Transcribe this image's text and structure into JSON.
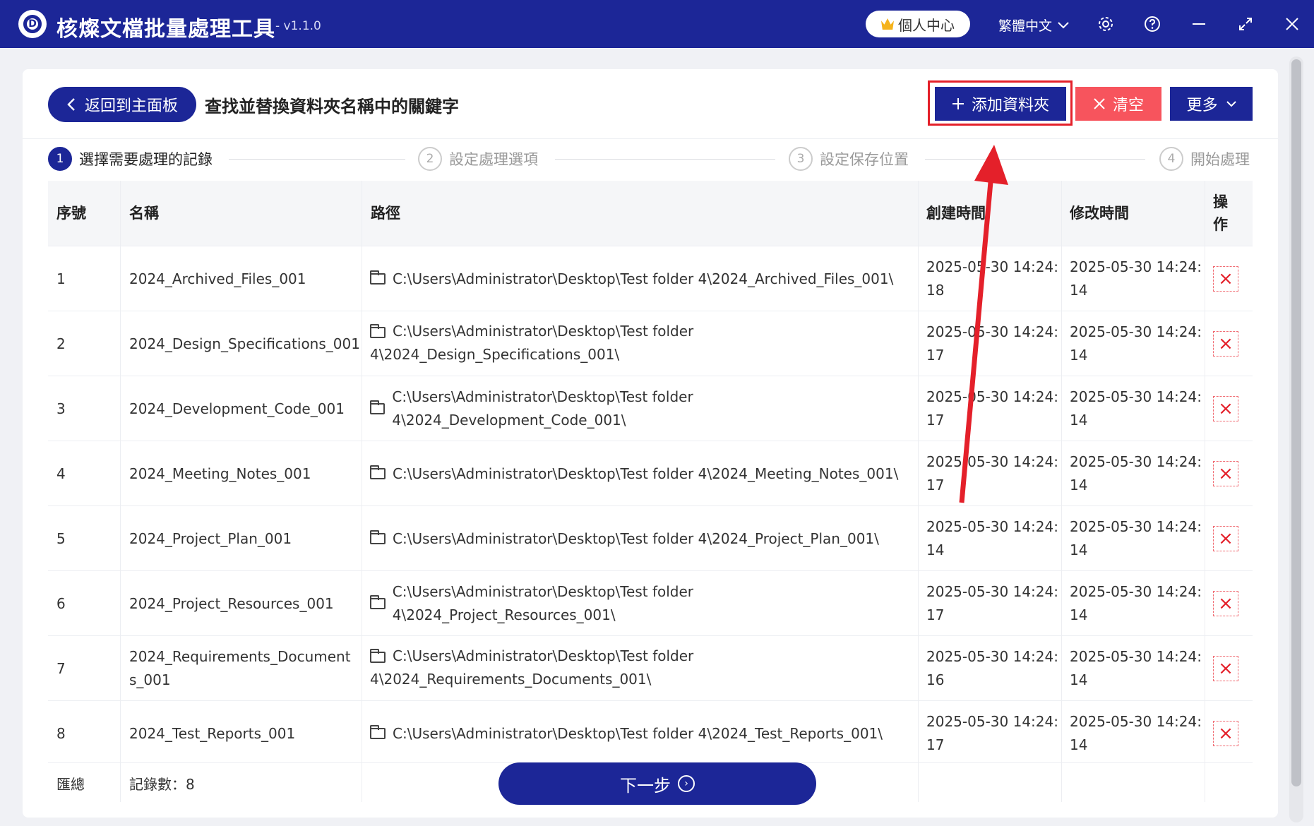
{
  "app": {
    "title": "核燦文檔批量處理工具",
    "version": "- v1.1.0",
    "user_center": "個人中心",
    "language": "繁體中文"
  },
  "toolbar": {
    "back_label": "返回到主面板",
    "page_title": "查找並替換資料夾名稱中的關鍵字",
    "add_folder_label": "添加資料夾",
    "clear_label": "清空",
    "more_label": "更多"
  },
  "steps": [
    {
      "num": "1",
      "label": "選擇需要處理的記錄"
    },
    {
      "num": "2",
      "label": "設定處理選項"
    },
    {
      "num": "3",
      "label": "設定保存位置"
    },
    {
      "num": "4",
      "label": "開始處理"
    }
  ],
  "table": {
    "headers": {
      "index": "序號",
      "name": "名稱",
      "path": "路徑",
      "created": "創建時間",
      "modified": "修改時間",
      "action_line1": "操",
      "action_line2": "作"
    },
    "rows": [
      {
        "index": "1",
        "name": "2024_Archived_Files_001",
        "path": "C:\\Users\\Administrator\\Desktop\\Test folder 4\\2024_Archived_Files_001\\",
        "created_line1": "2025-05-30 14:24:",
        "created_line2": "18",
        "modified_line1": "2025-05-30 14:24:",
        "modified_line2": "14"
      },
      {
        "index": "2",
        "name": "2024_Design_Specifications_001",
        "path": "C:\\Users\\Administrator\\Desktop\\Test folder 4\\2024_Design_Specifications_001\\",
        "created_line1": "2025-05-30 14:24:",
        "created_line2": "17",
        "modified_line1": "2025-05-30 14:24:",
        "modified_line2": "14"
      },
      {
        "index": "3",
        "name": "2024_Development_Code_001",
        "path": "C:\\Users\\Administrator\\Desktop\\Test folder 4\\2024_Development_Code_001\\",
        "created_line1": "2025-05-30 14:24:",
        "created_line2": "17",
        "modified_line1": "2025-05-30 14:24:",
        "modified_line2": "14"
      },
      {
        "index": "4",
        "name": "2024_Meeting_Notes_001",
        "path": "C:\\Users\\Administrator\\Desktop\\Test folder 4\\2024_Meeting_Notes_001\\",
        "created_line1": "2025-05-30 14:24:",
        "created_line2": "17",
        "modified_line1": "2025-05-30 14:24:",
        "modified_line2": "14"
      },
      {
        "index": "5",
        "name": "2024_Project_Plan_001",
        "path": "C:\\Users\\Administrator\\Desktop\\Test folder 4\\2024_Project_Plan_001\\",
        "created_line1": "2025-05-30 14:24:",
        "created_line2": "14",
        "modified_line1": "2025-05-30 14:24:",
        "modified_line2": "14"
      },
      {
        "index": "6",
        "name": "2024_Project_Resources_001",
        "path": "C:\\Users\\Administrator\\Desktop\\Test folder 4\\2024_Project_Resources_001\\",
        "created_line1": "2025-05-30 14:24:",
        "created_line2": "17",
        "modified_line1": "2025-05-30 14:24:",
        "modified_line2": "14"
      },
      {
        "index": "7",
        "name": "2024_Requirements_Documents_001",
        "path": "C:\\Users\\Administrator\\Desktop\\Test folder 4\\2024_Requirements_Documents_001\\",
        "created_line1": "2025-05-30 14:24:",
        "created_line2": "16",
        "modified_line1": "2025-05-30 14:24:",
        "modified_line2": "14"
      },
      {
        "index": "8",
        "name": "2024_Test_Reports_001",
        "path": "C:\\Users\\Administrator\\Desktop\\Test folder 4\\2024_Test_Reports_001\\",
        "created_line1": "2025-05-30 14:24:",
        "created_line2": "17",
        "modified_line1": "2025-05-30 14:24:",
        "modified_line2": "14"
      }
    ],
    "footer": {
      "summary_label": "匯總",
      "record_count_label": "記錄數：8"
    }
  },
  "next_label": "下一步",
  "colors": {
    "primary": "#1c2697",
    "danger": "#f7545d",
    "highlight": "#e4202a"
  }
}
